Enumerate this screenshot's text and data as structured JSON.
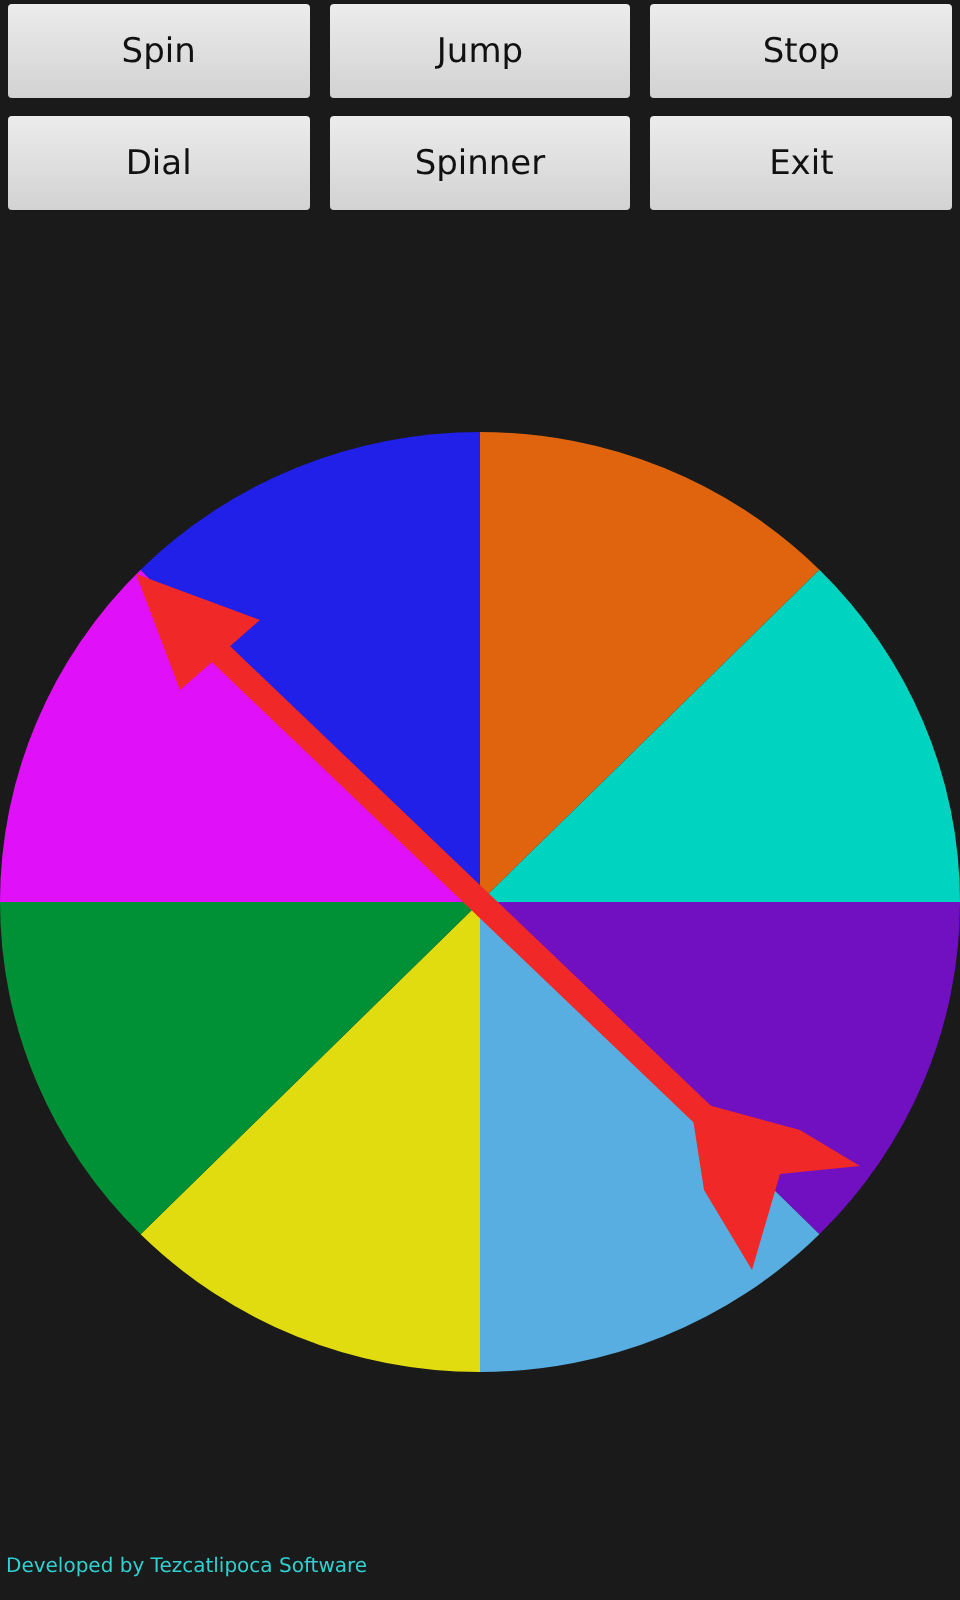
{
  "buttons": [
    {
      "label": "Spin"
    },
    {
      "label": "Jump"
    },
    {
      "label": "Stop"
    },
    {
      "label": "Dial"
    },
    {
      "label": "Spinner"
    },
    {
      "label": "Exit"
    }
  ],
  "wheel": {
    "segments": [
      {
        "color": "#e0640e"
      },
      {
        "color": "#00d4c0"
      },
      {
        "color": "#7010c0"
      },
      {
        "color": "#58aee0"
      },
      {
        "color": "#e0dc10"
      },
      {
        "color": "#009036"
      },
      {
        "color": "#e010f8"
      },
      {
        "color": "#2020e8"
      }
    ]
  },
  "footer": "Developed by Tezcatlipoca Software"
}
